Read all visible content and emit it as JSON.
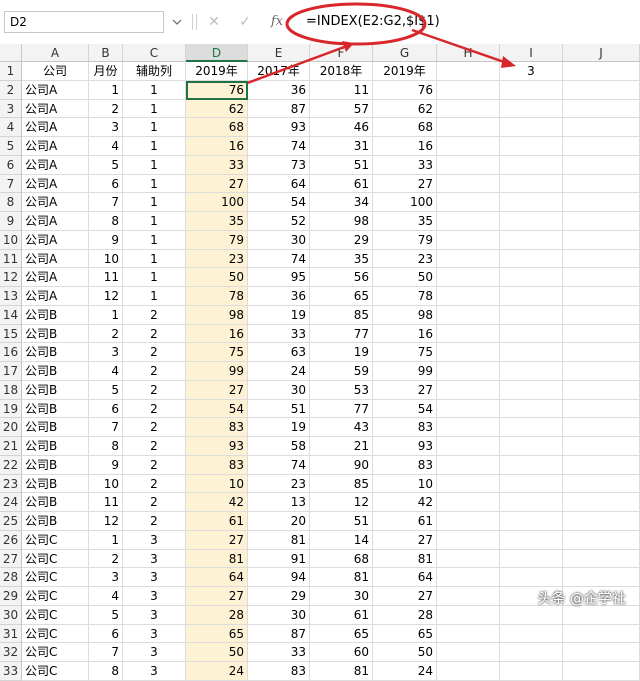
{
  "formula_bar": {
    "name_box": "D2",
    "cancel_icon": "close-icon",
    "enter_icon": "check-icon",
    "function_icon": "fx",
    "formula": "=INDEX(E2:G2,$I$1)"
  },
  "sheet": {
    "column_headers": [
      "A",
      "B",
      "C",
      "D",
      "E",
      "F",
      "G",
      "H",
      "I",
      "J"
    ],
    "header_row": [
      "公司",
      "月份",
      "辅助列",
      "2019年",
      "2017年",
      "2018年",
      "2019年"
    ],
    "i1_value": "3",
    "rows": [
      [
        "公司A",
        "1",
        "1",
        "76",
        "36",
        "11",
        "76"
      ],
      [
        "公司A",
        "2",
        "1",
        "62",
        "87",
        "57",
        "62"
      ],
      [
        "公司A",
        "3",
        "1",
        "68",
        "93",
        "46",
        "68"
      ],
      [
        "公司A",
        "4",
        "1",
        "16",
        "74",
        "31",
        "16"
      ],
      [
        "公司A",
        "5",
        "1",
        "33",
        "73",
        "51",
        "33"
      ],
      [
        "公司A",
        "6",
        "1",
        "27",
        "64",
        "61",
        "27"
      ],
      [
        "公司A",
        "7",
        "1",
        "100",
        "54",
        "34",
        "100"
      ],
      [
        "公司A",
        "8",
        "1",
        "35",
        "52",
        "98",
        "35"
      ],
      [
        "公司A",
        "9",
        "1",
        "79",
        "30",
        "29",
        "79"
      ],
      [
        "公司A",
        "10",
        "1",
        "23",
        "74",
        "35",
        "23"
      ],
      [
        "公司A",
        "11",
        "1",
        "50",
        "95",
        "56",
        "50"
      ],
      [
        "公司A",
        "12",
        "1",
        "78",
        "36",
        "65",
        "78"
      ],
      [
        "公司B",
        "1",
        "2",
        "98",
        "19",
        "85",
        "98"
      ],
      [
        "公司B",
        "2",
        "2",
        "16",
        "33",
        "77",
        "16"
      ],
      [
        "公司B",
        "3",
        "2",
        "75",
        "63",
        "19",
        "75"
      ],
      [
        "公司B",
        "4",
        "2",
        "99",
        "24",
        "59",
        "99"
      ],
      [
        "公司B",
        "5",
        "2",
        "27",
        "30",
        "53",
        "27"
      ],
      [
        "公司B",
        "6",
        "2",
        "54",
        "51",
        "77",
        "54"
      ],
      [
        "公司B",
        "7",
        "2",
        "83",
        "19",
        "43",
        "83"
      ],
      [
        "公司B",
        "8",
        "2",
        "93",
        "58",
        "21",
        "93"
      ],
      [
        "公司B",
        "9",
        "2",
        "83",
        "74",
        "90",
        "83"
      ],
      [
        "公司B",
        "10",
        "2",
        "10",
        "23",
        "85",
        "10"
      ],
      [
        "公司B",
        "11",
        "2",
        "42",
        "13",
        "12",
        "42"
      ],
      [
        "公司B",
        "12",
        "2",
        "61",
        "20",
        "51",
        "61"
      ],
      [
        "公司C",
        "1",
        "3",
        "27",
        "81",
        "14",
        "27"
      ],
      [
        "公司C",
        "2",
        "3",
        "81",
        "91",
        "68",
        "81"
      ],
      [
        "公司C",
        "3",
        "3",
        "64",
        "94",
        "81",
        "64"
      ],
      [
        "公司C",
        "4",
        "3",
        "27",
        "29",
        "30",
        "27"
      ],
      [
        "公司C",
        "5",
        "3",
        "28",
        "30",
        "61",
        "28"
      ],
      [
        "公司C",
        "6",
        "3",
        "65",
        "87",
        "65",
        "65"
      ],
      [
        "公司C",
        "7",
        "3",
        "50",
        "33",
        "60",
        "50"
      ],
      [
        "公司C",
        "8",
        "3",
        "24",
        "83",
        "81",
        "24"
      ]
    ]
  },
  "annotation": {
    "color": "#d9262b"
  },
  "watermark": "头条 @企学社"
}
